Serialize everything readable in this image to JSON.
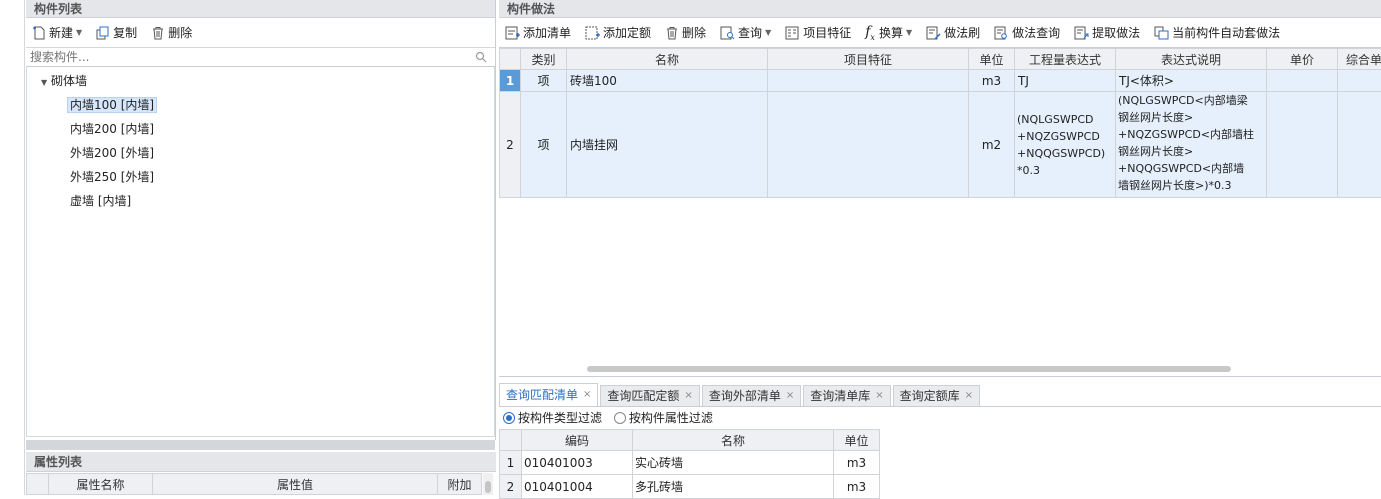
{
  "left": {
    "title": "构件列表",
    "toolbar": {
      "new_label": "新建",
      "copy_label": "复制",
      "delete_label": "删除"
    },
    "search_placeholder": "搜索构件...",
    "tree": {
      "root": "砌体墙",
      "items": [
        "内墙100 [内墙]",
        "内墙200 [内墙]",
        "外墙200 [外墙]",
        "外墙250 [外墙]",
        "虚墙 [内墙]"
      ]
    },
    "props": {
      "title": "属性列表",
      "columns": [
        "属性名称",
        "属性值",
        "附加"
      ]
    }
  },
  "right": {
    "title": "构件做法",
    "toolbar": {
      "add_list": "添加清单",
      "add_quota": "添加定额",
      "delete": "删除",
      "query": "查询",
      "item_feature": "项目特征",
      "convert": "换算",
      "method_brush": "做法刷",
      "method_query": "做法查询",
      "extract_method": "提取做法",
      "auto_apply": "当前构件自动套做法"
    },
    "grid": {
      "columns": [
        "类别",
        "名称",
        "项目特征",
        "单位",
        "工程量表达式",
        "表达式说明",
        "单价",
        "综合单"
      ],
      "rows": [
        {
          "no": "1",
          "type": "项",
          "name": "砖墙100",
          "feature": "",
          "unit": "m3",
          "expr": "TJ",
          "desc": "TJ<体积>",
          "price": "",
          "total": ""
        },
        {
          "no": "2",
          "type": "项",
          "name": "内墙挂网",
          "feature": "",
          "unit": "m2",
          "expr_lines": [
            "(NQLGSWPCD",
            "+NQZGSWPCD",
            "+NQQGSWPCD)",
            "*0.3"
          ],
          "desc_lines": [
            "(NQLGSWPCD<内部墙梁",
            "钢丝网片长度>",
            "+NQZGSWPCD<内部墙柱",
            "钢丝网片长度>",
            "+NQQGSWPCD<内部墙",
            "墙钢丝网片长度>)*0.3"
          ],
          "price": "",
          "total": ""
        }
      ]
    },
    "tabs": [
      {
        "label": "查询匹配清单",
        "active": true
      },
      {
        "label": "查询匹配定额",
        "active": false
      },
      {
        "label": "查询外部清单",
        "active": false
      },
      {
        "label": "查询清单库",
        "active": false
      },
      {
        "label": "查询定额库",
        "active": false
      }
    ],
    "filter": {
      "by_type": "按构件类型过滤",
      "by_attr": "按构件属性过滤"
    },
    "bottom_grid": {
      "columns": [
        "编码",
        "名称",
        "单位"
      ],
      "rows": [
        {
          "no": "1",
          "code": "010401003",
          "name": "实心砖墙",
          "unit": "m3"
        },
        {
          "no": "2",
          "code": "010401004",
          "name": "多孔砖墙",
          "unit": "m3"
        }
      ]
    }
  }
}
